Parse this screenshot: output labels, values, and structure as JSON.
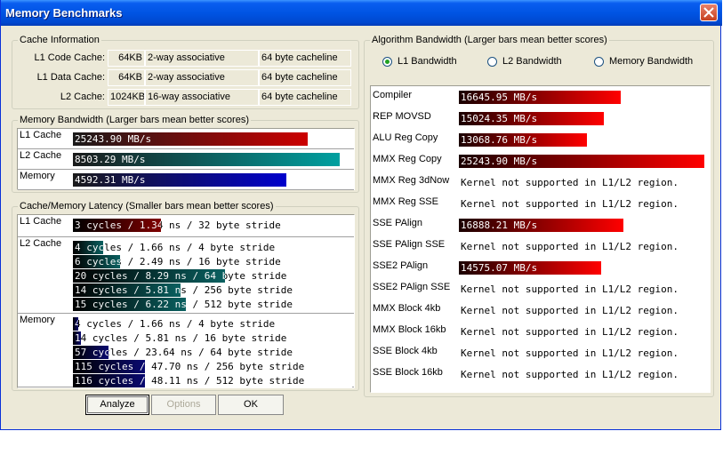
{
  "window": {
    "title": "Memory Benchmarks"
  },
  "cache_info": {
    "legend": "Cache Information",
    "rows": [
      {
        "label": "L1 Code Cache:",
        "size": "64KB",
        "assoc": "2-way associative",
        "line": "64 byte cacheline"
      },
      {
        "label": "L1 Data Cache:",
        "size": "64KB",
        "assoc": "2-way associative",
        "line": "64 byte cacheline"
      },
      {
        "label": "L2 Cache:",
        "size": "1024KB",
        "assoc": "16-way associative",
        "line": "64 byte cacheline"
      }
    ]
  },
  "mem_bandwidth": {
    "legend": "Memory Bandwidth (Larger bars mean better scores)",
    "rows": [
      {
        "label": "L1 Cache",
        "text": "25243.90 MB/s",
        "fill": 0.88,
        "color": "#cc0000"
      },
      {
        "label": "L2 Cache",
        "text": "8503.29 MB/s",
        "fill": 1.0,
        "color": "#00a0a0"
      },
      {
        "label": "Memory",
        "text": "4592.31 MB/s",
        "fill": 0.8,
        "color": "#0000cc"
      }
    ]
  },
  "latency": {
    "legend": "Cache/Memory Latency (Smaller bars mean better scores)",
    "sections": [
      {
        "label": "L1 Cache",
        "color": "#800000",
        "rows": [
          {
            "text": "3 cycles / 1.34 ns / 32 byte stride",
            "fill": 0.32
          }
        ]
      },
      {
        "label": "L2 Cache",
        "color": "#0a6060",
        "rows": [
          {
            "text": "4 cycles / 1.66 ns / 4 byte stride",
            "fill": 0.11
          },
          {
            "text": "6 cycles / 2.49 ns / 16 byte stride",
            "fill": 0.17
          },
          {
            "text": "20 cycles / 8.29 ns / 64 byte stride",
            "fill": 0.55
          },
          {
            "text": "14 cycles / 5.81 ns / 256 byte stride",
            "fill": 0.39
          },
          {
            "text": "15 cycles / 6.22 ns / 512 byte stride",
            "fill": 0.41
          }
        ]
      },
      {
        "label": "Memory",
        "color": "#0a0a70",
        "rows": [
          {
            "text": "4 cycles / 1.66 ns / 4 byte stride",
            "fill": 0.02
          },
          {
            "text": "14 cycles / 5.81 ns / 16 byte stride",
            "fill": 0.03
          },
          {
            "text": "57 cycles / 23.64 ns / 64 byte stride",
            "fill": 0.13
          },
          {
            "text": "115 cycles / 47.70 ns / 256 byte stride",
            "fill": 0.26
          },
          {
            "text": "116 cycles / 48.11 ns / 512 byte stride",
            "fill": 0.26
          }
        ]
      }
    ]
  },
  "algo": {
    "legend": "Algorithm Bandwidth (Larger bars mean better scores)",
    "radios": [
      {
        "label": "L1 Bandwidth",
        "selected": true
      },
      {
        "label": "L2 Bandwidth",
        "selected": false
      },
      {
        "label": "Memory Bandwidth",
        "selected": false
      }
    ],
    "rows": [
      {
        "label": "Compiler",
        "text": "16645.95 MB/s",
        "fill": 0.66
      },
      {
        "label": "REP MOVSD",
        "text": "15024.35 MB/s",
        "fill": 0.59
      },
      {
        "label": "ALU Reg Copy",
        "text": "13068.76 MB/s",
        "fill": 0.52
      },
      {
        "label": "MMX Reg Copy",
        "text": "25243.90 MB/s",
        "fill": 1.0
      },
      {
        "label": "MMX Reg 3dNow",
        "text": "Kernel not supported in L1/L2 region.",
        "fill": 0
      },
      {
        "label": "MMX Reg SSE",
        "text": "Kernel not supported in L1/L2 region.",
        "fill": 0
      },
      {
        "label": "SSE PAlign",
        "text": "16888.21 MB/s",
        "fill": 0.67
      },
      {
        "label": "SSE PAlign SSE",
        "text": "Kernel not supported in L1/L2 region.",
        "fill": 0
      },
      {
        "label": "SSE2 PAlign",
        "text": "14575.07 MB/s",
        "fill": 0.58
      },
      {
        "label": "SSE2 PAlign SSE",
        "text": "Kernel not supported in L1/L2 region.",
        "fill": 0
      },
      {
        "label": "MMX Block 4kb",
        "text": "Kernel not supported in L1/L2 region.",
        "fill": 0
      },
      {
        "label": "MMX Block 16kb",
        "text": "Kernel not supported in L1/L2 region.",
        "fill": 0
      },
      {
        "label": "SSE Block 4kb",
        "text": "Kernel not supported in L1/L2 region.",
        "fill": 0
      },
      {
        "label": "SSE Block 16kb",
        "text": "Kernel not supported in L1/L2 region.",
        "fill": 0
      }
    ]
  },
  "buttons": {
    "analyze": "Analyze",
    "options": "Options",
    "ok": "OK"
  }
}
